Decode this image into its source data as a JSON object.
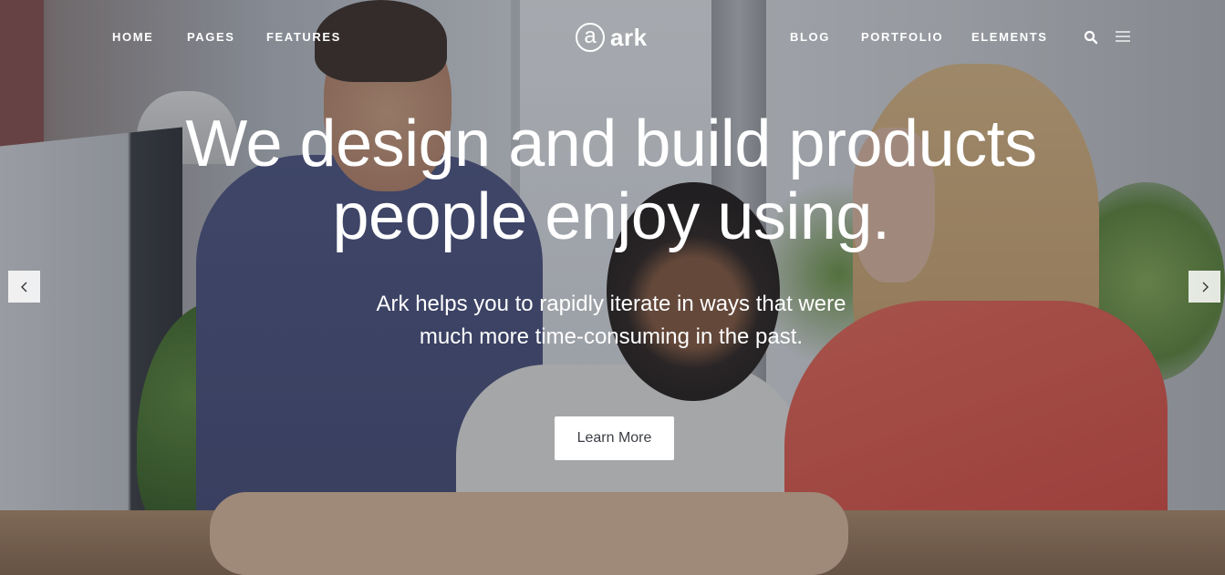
{
  "header": {
    "nav_left": [
      "HOME",
      "PAGES",
      "FEATURES"
    ],
    "nav_right": [
      "BLOG",
      "PORTFOLIO",
      "ELEMENTS"
    ],
    "logo_letter": "a",
    "logo_text": "ark",
    "icons": [
      "search-icon",
      "menu-icon"
    ]
  },
  "hero": {
    "headline_line1": "We design and build products",
    "headline_line2": "people enjoy using.",
    "subline_line1": "Ark helps you to rapidly iterate in ways that were",
    "subline_line2": "much more time-consuming in the past.",
    "cta_label": "Learn More"
  },
  "slider": {
    "prev_icon": "chevron-left-icon",
    "next_icon": "chevron-right-icon"
  },
  "colors": {
    "text": "#ffffff",
    "button_bg": "#ffffff",
    "button_text": "#3b3e45"
  }
}
